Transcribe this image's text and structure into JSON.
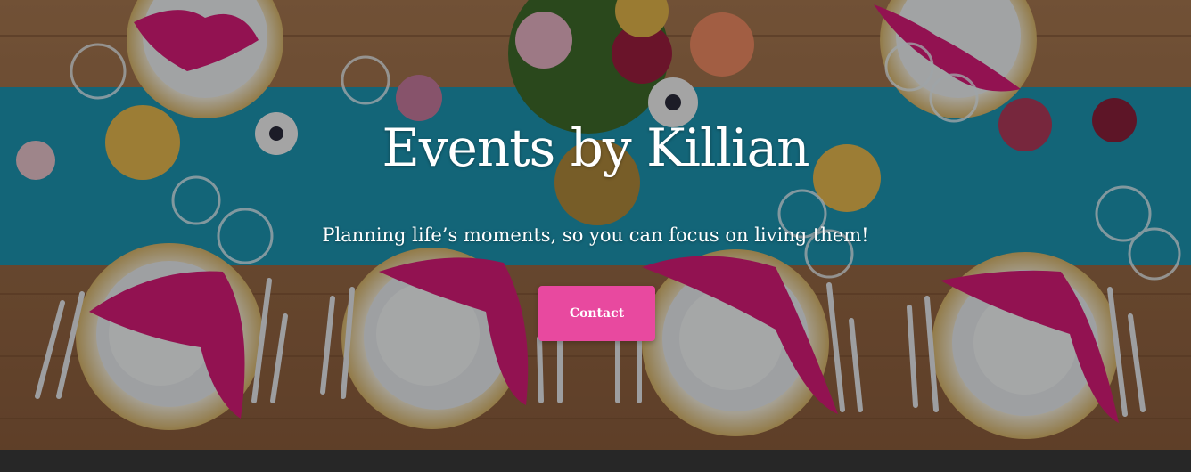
{
  "hero": {
    "title": "Events by Killian",
    "tagline": "Planning life’s moments, so you can focus on living them!",
    "contact_label": "Contact",
    "background_description": "Overhead view of a wooden banquet table with a teal runner, white plates, pink knotted napkins, cutlery, glasses and flower arrangements"
  },
  "colors": {
    "accent": "#e8499f",
    "text": "#ffffff",
    "runner": "#1f9cb8",
    "table": "#9a6a45",
    "napkin": "#d81b78"
  }
}
